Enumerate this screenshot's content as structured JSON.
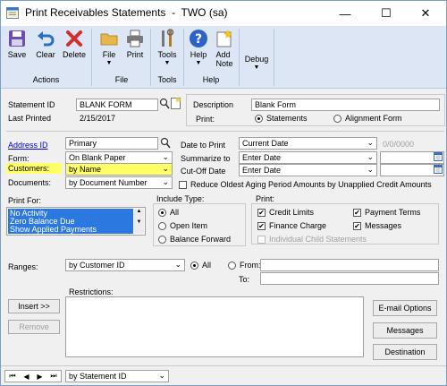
{
  "window": {
    "title": "Print Receivables Statements  -  TWO (sa)",
    "minimize_glyph": "—",
    "maximize_glyph": "☐",
    "close_glyph": "✕"
  },
  "ribbon": {
    "groups": {
      "actions": "Actions",
      "file": "File",
      "tools": "Tools",
      "help": "Help",
      "debug": ""
    },
    "buttons": {
      "save": "Save",
      "clear": "Clear",
      "delete": "Delete",
      "file": "File",
      "print": "Print",
      "tools": "Tools",
      "help": "Help",
      "add_note_line1": "Add",
      "add_note_line2": "Note",
      "debug": "Debug"
    },
    "dropdown_glyph": "▼"
  },
  "form": {
    "statement_id_label": "Statement ID",
    "statement_id": "BLANK FORM",
    "description_label": "Description",
    "description": "Blank Form",
    "last_printed_label": "Last Printed",
    "last_printed": "2/15/2017",
    "print_label": "Print:",
    "print_opt_statements": "Statements",
    "print_opt_alignment": "Alignment Form",
    "address_id_label": "Address ID",
    "address_id": "Primary",
    "form_label": "Form:",
    "form_value": "On Blank Paper",
    "customers_label": "Customers:",
    "customers_value": "by Name",
    "documents_label": "Documents:",
    "documents_value": "by Document Number",
    "date_to_print_label": "Date to Print",
    "date_to_print_value": "Current Date",
    "date_to_print_date": "0/0/0000",
    "summarize_to_label": "Summarize to",
    "summarize_to_value": "Enter Date",
    "cutoff_label": "Cut-Off Date",
    "cutoff_value": "Enter Date",
    "reduce_aging_label": "Reduce Oldest Aging Period Amounts by Unapplied Credit Amounts",
    "print_for_label": "Print For:",
    "print_for_items": [
      "No Activity",
      "Zero Balance Due",
      "Show Applied Payments"
    ],
    "include_type_label": "Include Type:",
    "include_all": "All",
    "include_open_item": "Open Item",
    "include_balance_forward": "Balance Forward",
    "print_group_label": "Print:",
    "print_credit_limits": "Credit Limits",
    "print_payment_terms": "Payment Terms",
    "print_finance_charge": "Finance Charge",
    "print_messages": "Messages",
    "print_individual_child": "Individual Child Statements",
    "check_glyph": "✔",
    "ranges_label": "Ranges:",
    "ranges_value": "by Customer ID",
    "ranges_all": "All",
    "ranges_from": "From:",
    "ranges_to": "To:",
    "restrictions_label": "Restrictions:",
    "insert_button": "Insert >>",
    "remove_button": "Remove",
    "email_options_button": "E-mail Options",
    "messages_button": "Messages",
    "destination_button": "Destination",
    "browse_value": "by Statement ID"
  }
}
